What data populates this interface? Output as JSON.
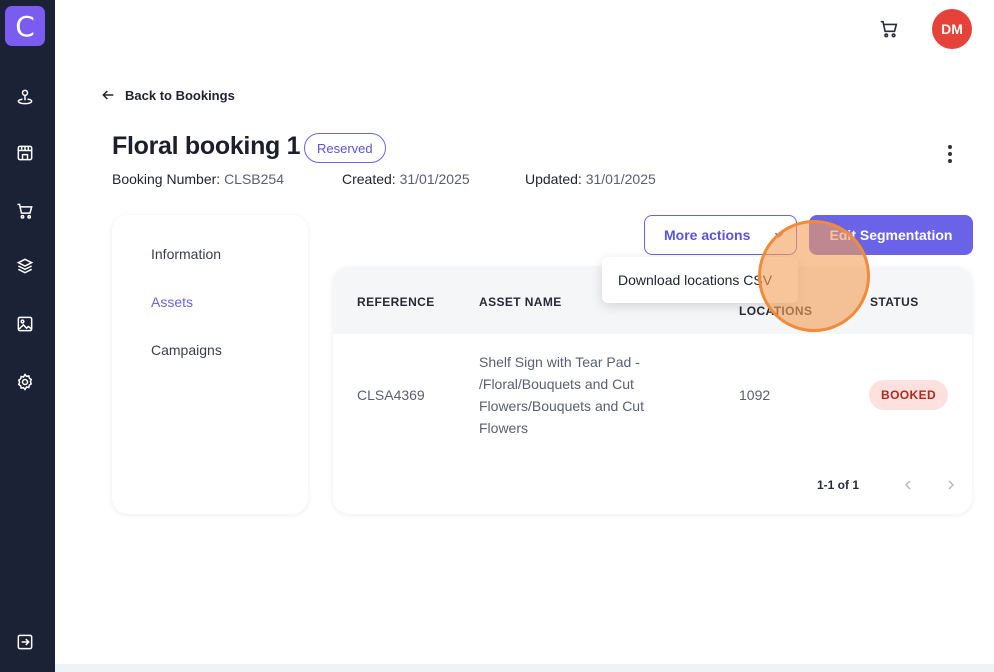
{
  "app": {
    "logo_letter": "C",
    "accent": "#6a63e8",
    "sidebar_bg": "#1b2236"
  },
  "sidebar": {
    "items": [
      {
        "icon": "home-pin-icon"
      },
      {
        "icon": "store-icon"
      },
      {
        "icon": "cart-icon"
      },
      {
        "icon": "layers-icon"
      },
      {
        "icon": "image-icon"
      },
      {
        "icon": "settings-icon"
      }
    ],
    "logout_icon": "logout-icon"
  },
  "header": {
    "avatar_initials": "DM",
    "cart_icon": "cart-icon"
  },
  "back_link": {
    "label": "Back to Bookings"
  },
  "booking": {
    "title": "Floral booking 1",
    "status": "Reserved",
    "number_label": "Booking Number:",
    "number": "CLSB254",
    "created_label": "Created:",
    "created": "31/01/2025",
    "updated_label": "Updated:",
    "updated": "31/01/2025"
  },
  "side_nav": {
    "items": [
      {
        "label": "Information",
        "active": false
      },
      {
        "label": "Assets",
        "active": true
      },
      {
        "label": "Campaigns",
        "active": false
      }
    ]
  },
  "actions": {
    "more_actions": "More actions",
    "edit_segmentation": "Edit Segmentation",
    "dropdown_item": "Download locations CSV"
  },
  "table": {
    "headers": {
      "reference": "REFERENCE",
      "asset_name": "ASSET NAME",
      "locations": "LOCATIONS",
      "status": "STATUS"
    },
    "rows": [
      {
        "reference": "CLSA4369",
        "asset_name_lines": [
          "Shelf Sign with Tear Pad -",
          "/Floral/Bouquets and Cut",
          "Flowers/Bouquets and Cut",
          "Flowers"
        ],
        "locations": "1092",
        "status": "BOOKED"
      }
    ],
    "pagination": "1-1 of 1"
  }
}
